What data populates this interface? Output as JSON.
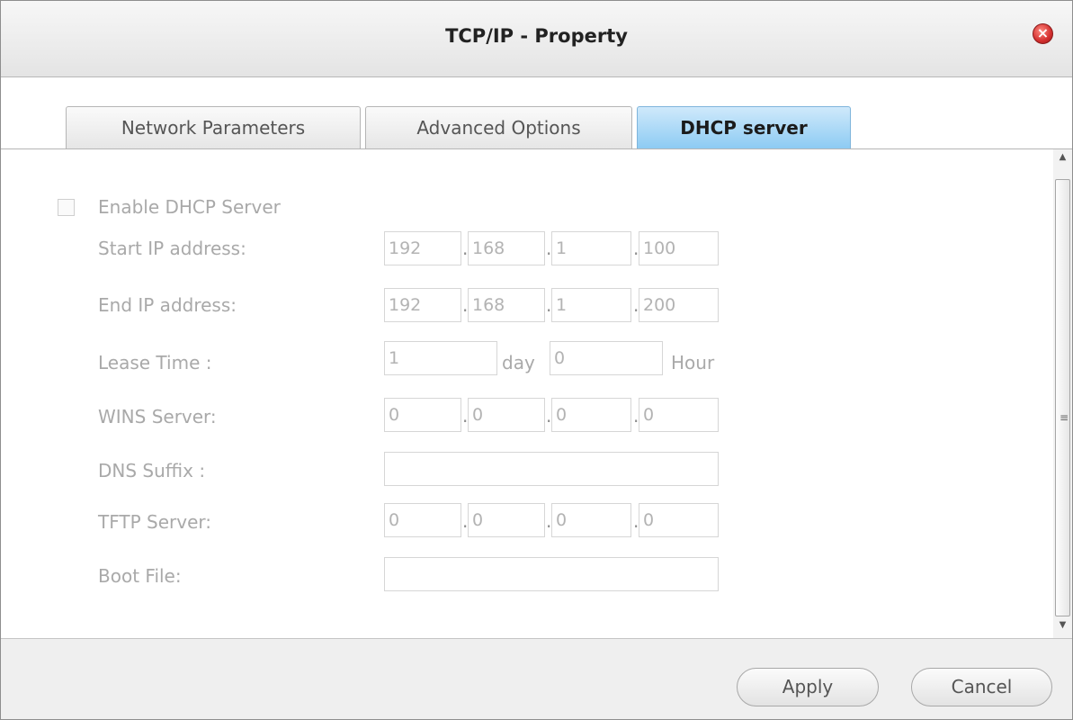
{
  "window": {
    "title": "TCP/IP - Property",
    "close_icon": "×"
  },
  "tabs": [
    {
      "label": "Network Parameters",
      "active": false
    },
    {
      "label": "Advanced Options",
      "active": false
    },
    {
      "label": "DHCP server",
      "active": true
    }
  ],
  "form": {
    "enable_label": "Enable DHCP Server",
    "enable_checked": false,
    "start_ip": {
      "label": "Start IP address:",
      "octets": [
        "192",
        "168",
        "1",
        "100"
      ]
    },
    "end_ip": {
      "label": "End IP address:",
      "octets": [
        "192",
        "168",
        "1",
        "200"
      ]
    },
    "lease": {
      "label": "Lease Time :",
      "days": "1",
      "day_unit": "day",
      "hours": "0",
      "hour_unit": "Hour"
    },
    "wins": {
      "label": "WINS Server:",
      "octets": [
        "0",
        "0",
        "0",
        "0"
      ]
    },
    "dns_suffix": {
      "label": "DNS Suffix :",
      "value": ""
    },
    "tftp": {
      "label": "TFTP Server:",
      "octets": [
        "0",
        "0",
        "0",
        "0"
      ]
    },
    "boot_file": {
      "label": "Boot File:",
      "value": ""
    },
    "ip_separator": "."
  },
  "buttons": {
    "apply": "Apply",
    "cancel": "Cancel"
  },
  "colors": {
    "active_tab": "#8dcbf3",
    "disabled_text": "#a9a9a9",
    "close": "#d32f2f"
  }
}
